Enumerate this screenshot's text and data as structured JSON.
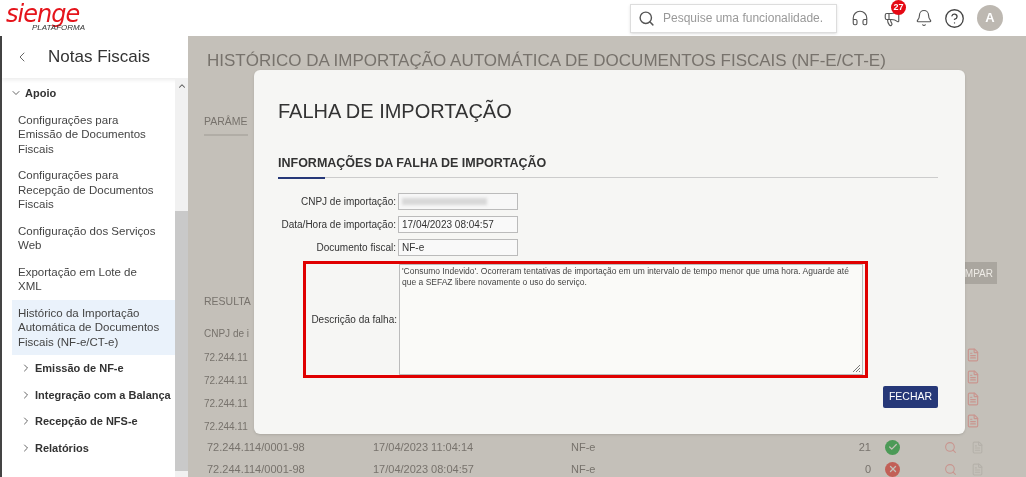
{
  "header": {
    "logo": "sienge",
    "logo_sub": "PLATAFORMA",
    "search": {
      "placeholder": "Pesquise uma funcionalidade."
    },
    "notifications_badge": "27",
    "avatar": "A"
  },
  "sidebar": {
    "title": "Notas Fiscais",
    "items": [
      {
        "label": "Apoio",
        "expanded": true,
        "selected": false,
        "children": [
          {
            "label": "Configurações para Emissão de Documentos Fiscais",
            "selected": false
          },
          {
            "label": "Configurações para Recepção de Documentos Fiscais",
            "selected": false
          },
          {
            "label": "Configuração dos Serviços Web",
            "selected": false
          },
          {
            "label": "Exportação em Lote de XML",
            "selected": false
          },
          {
            "label": "Histórico da Importação Automática de Documentos Fiscais (NF-e/CT-e)",
            "selected": true
          }
        ]
      },
      {
        "label": "Emissão de NF-e",
        "expanded": false,
        "selected": false
      },
      {
        "label": "Integração com a Balança",
        "expanded": false,
        "selected": false
      },
      {
        "label": "Recepção de NFS-e",
        "expanded": false,
        "selected": false
      },
      {
        "label": "Relatórios",
        "expanded": false,
        "selected": false
      }
    ]
  },
  "page": {
    "title": "HISTÓRICO DA IMPORTAÇÃO AUTOMÁTICA DE DOCUMENTOS FISCAIS (NF-E/CT-E)",
    "tab": "PARÂME",
    "results_heading": "RESULTA",
    "clear_button": "MPAR",
    "column_1": "CNPJ de i",
    "partial_rows": [
      "72.244.11",
      "72.244.11",
      "72.244.11",
      "72.244.11"
    ],
    "rows": [
      {
        "cnpj": "72.244.114/0001-98",
        "date": "17/04/2023 11:04:14",
        "type": "NF-e",
        "count": "21",
        "success": true
      },
      {
        "cnpj": "72.244.114/0001-98",
        "date": "17/04/2023 08:04:57",
        "type": "NF-e",
        "count": "0",
        "success": false
      }
    ]
  },
  "dialog": {
    "title": "FALHA DE IMPORTAÇÃO",
    "section": "INFORMAÇÕES DA FALHA DE IMPORTAÇÃO",
    "fields": [
      {
        "label": "CNPJ de importação:",
        "kind": "redacted"
      },
      {
        "label": "Data/Hora de importação:",
        "kind": "text",
        "value": "17/04/2023 08:04:57"
      },
      {
        "label": "Documento fiscal:",
        "kind": "text",
        "value": "NF-e"
      }
    ],
    "description": {
      "label": "Descrição da falha:",
      "value": "'Consumo Indevido'. Ocorreram tentativas de importação em um intervalo de tempo menor que uma hora. Aguarde até que a SEFAZ libere novamente o uso do serviço.",
      "highlighted": true
    },
    "close_button": "FECHAR"
  }
}
